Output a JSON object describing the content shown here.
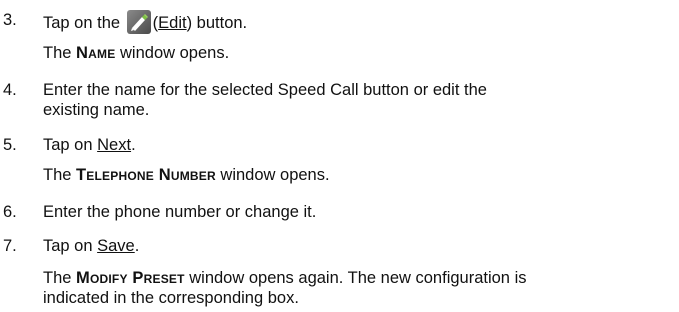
{
  "steps": [
    {
      "number": "3.",
      "parts": {
        "a": "Tap on the ",
        "icon": "pencil-edit-icon",
        "b": "(",
        "link": "Edit",
        "c": ") button."
      },
      "result": {
        "pre": "The ",
        "strong": "Name",
        "post": " window opens."
      }
    },
    {
      "number": "4.",
      "line1": "Enter the name for the selected Speed Call button or edit the",
      "line2": "existing name."
    },
    {
      "number": "5.",
      "parts": {
        "a": "Tap on ",
        "link": "Next",
        "c": "."
      },
      "result": {
        "pre": "The ",
        "strong": "Telephone Number",
        "post": " window opens."
      }
    },
    {
      "number": "6.",
      "line1": "Enter the phone number or change it."
    },
    {
      "number": "7.",
      "parts": {
        "a": "Tap on ",
        "link": "Save",
        "c": "."
      },
      "result": {
        "pre": "The ",
        "strong": "Modify Preset",
        "post": " window opens again. The new configuration is",
        "line2": "indicated in the corresponding box."
      }
    }
  ]
}
